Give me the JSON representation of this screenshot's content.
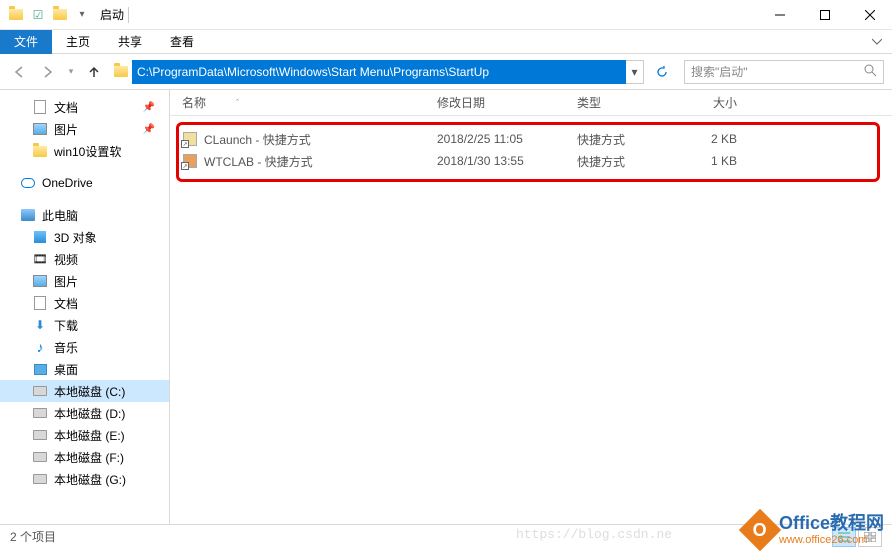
{
  "titlebar": {
    "title": "启动"
  },
  "ribbon": {
    "file": "文件",
    "home": "主页",
    "share": "共享",
    "view": "查看"
  },
  "navbar": {
    "path": "C:\\ProgramData\\Microsoft\\Windows\\Start Menu\\Programs\\StartUp",
    "search_placeholder": "搜索\"启动\""
  },
  "sidebar": {
    "quick": [
      {
        "label": "文档"
      },
      {
        "label": "图片"
      },
      {
        "label": "win10设置软"
      }
    ],
    "onedrive": "OneDrive",
    "thispc": "此电脑",
    "pc_items": [
      {
        "label": "3D 对象"
      },
      {
        "label": "视频"
      },
      {
        "label": "图片"
      },
      {
        "label": "文档"
      },
      {
        "label": "下载"
      },
      {
        "label": "音乐"
      },
      {
        "label": "桌面"
      },
      {
        "label": "本地磁盘 (C:)"
      },
      {
        "label": "本地磁盘 (D:)"
      },
      {
        "label": "本地磁盘 (E:)"
      },
      {
        "label": "本地磁盘 (F:)"
      },
      {
        "label": "本地磁盘 (G:)"
      }
    ]
  },
  "columns": {
    "name": "名称",
    "date": "修改日期",
    "type": "类型",
    "size": "大小"
  },
  "files": [
    {
      "name": "CLaunch - 快捷方式",
      "date": "2018/2/25 11:05",
      "type": "快捷方式",
      "size": "2 KB"
    },
    {
      "name": "WTCLAB - 快捷方式",
      "date": "2018/1/30 13:55",
      "type": "快捷方式",
      "size": "1 KB"
    }
  ],
  "statusbar": {
    "count": "2 个项目"
  },
  "watermark": {
    "url1": "https://blog.csdn.ne",
    "brand": "Office教程网",
    "site": "www.office26.com"
  }
}
